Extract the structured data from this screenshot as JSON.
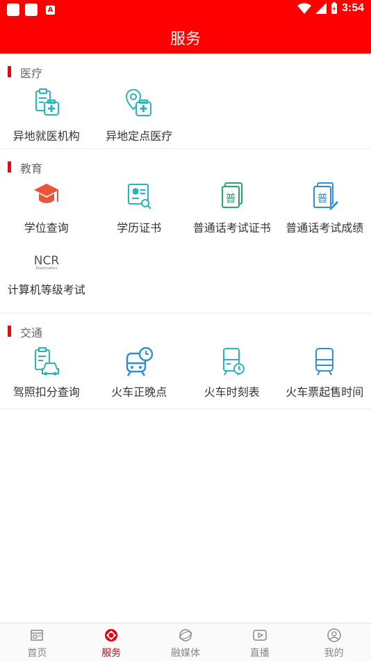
{
  "status_bar": {
    "time": "3:54",
    "notif_letter": "A"
  },
  "header": {
    "title": "服务"
  },
  "sections": [
    {
      "title": "医疗",
      "items": [
        {
          "label": "异地就医机构",
          "icon": "clipboard-medkit-icon"
        },
        {
          "label": "异地定点医疗",
          "icon": "location-medkit-icon"
        }
      ]
    },
    {
      "title": "教育",
      "items": [
        {
          "label": "学位查询",
          "icon": "graduation-cap-icon"
        },
        {
          "label": "学历证书",
          "icon": "certificate-search-icon"
        },
        {
          "label": "普通话考试证书",
          "icon": "mandarin-certificate-icon"
        },
        {
          "label": "普通话考试成绩",
          "icon": "mandarin-score-icon"
        },
        {
          "label": "计算机等级考试",
          "icon": "ncre-logo-icon",
          "logo_text": "NCR",
          "logo_sub": "Examination"
        }
      ]
    },
    {
      "title": "交通",
      "items": [
        {
          "label": "驾照扣分查询",
          "icon": "license-car-icon"
        },
        {
          "label": "火车正晚点",
          "icon": "train-clock-icon"
        },
        {
          "label": "火车时刻表",
          "icon": "train-timetable-icon"
        },
        {
          "label": "火车票起售时间",
          "icon": "train-ticket-icon"
        }
      ]
    }
  ],
  "bottom_nav": [
    {
      "label": "首页",
      "icon": "home-icon",
      "active": false
    },
    {
      "label": "服务",
      "icon": "service-icon",
      "active": true
    },
    {
      "label": "融媒体",
      "icon": "media-icon",
      "active": false
    },
    {
      "label": "直播",
      "icon": "live-icon",
      "active": false
    },
    {
      "label": "我的",
      "icon": "profile-icon",
      "active": false
    }
  ],
  "colors": {
    "brand": "#ff0000",
    "icon_teal": "#26b5bf",
    "icon_blue": "#2e8fd6",
    "icon_orange": "#e8553a",
    "active_nav": "#e60012"
  }
}
